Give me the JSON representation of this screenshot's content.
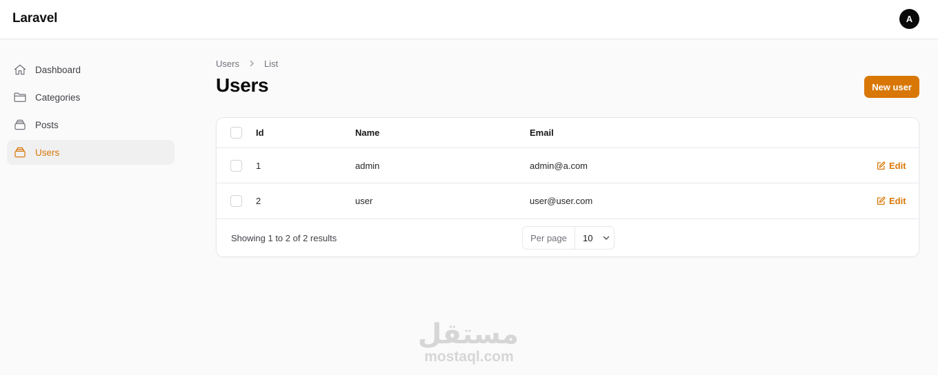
{
  "app": {
    "brand": "Laravel",
    "avatar_initial": "A"
  },
  "sidebar": {
    "items": [
      {
        "label": "Dashboard",
        "icon": "home-icon",
        "active": false
      },
      {
        "label": "Categories",
        "icon": "folder-icon",
        "active": false
      },
      {
        "label": "Posts",
        "icon": "collection-icon",
        "active": false
      },
      {
        "label": "Users",
        "icon": "collection-icon",
        "active": true
      }
    ]
  },
  "breadcrumb": {
    "items": [
      "Users",
      "List"
    ]
  },
  "page": {
    "title": "Users",
    "new_button": "New user"
  },
  "table": {
    "columns": [
      "Id",
      "Name",
      "Email"
    ],
    "rows": [
      {
        "id": "1",
        "name": "admin",
        "email": "admin@a.com",
        "action": "Edit"
      },
      {
        "id": "2",
        "name": "user",
        "email": "user@user.com",
        "action": "Edit"
      }
    ],
    "summary": "Showing 1 to 2 of 2 results",
    "per_page_label": "Per page",
    "per_page_value": "10"
  },
  "watermark": {
    "arabic": "مستقل",
    "latin": "mostaql.com"
  },
  "colors": {
    "accent": "#d97706",
    "background": "#fafafa",
    "border": "#e5e7eb"
  }
}
